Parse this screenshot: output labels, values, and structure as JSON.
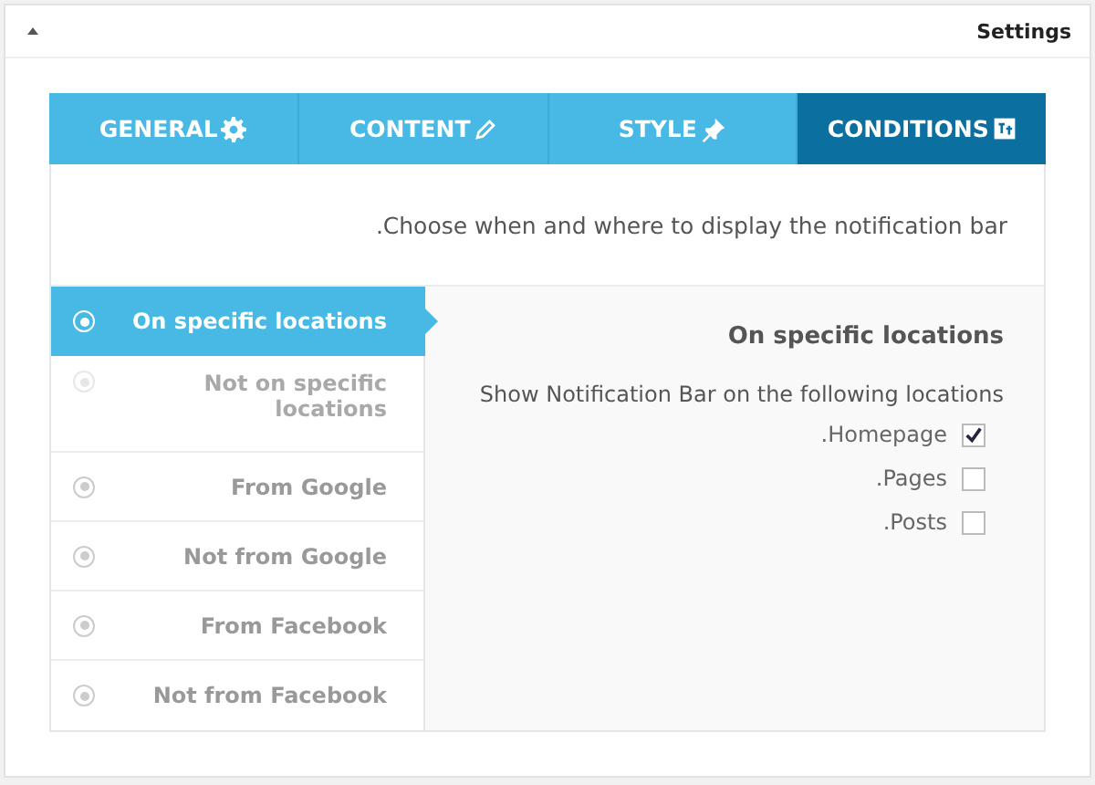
{
  "panel": {
    "title": "Settings",
    "expanded": true
  },
  "tabs": [
    {
      "label": "GENERAL",
      "selected": false
    },
    {
      "label": "CONTENT",
      "selected": false
    },
    {
      "label": "STYLE",
      "selected": false
    },
    {
      "label": "CONDITIONS",
      "selected": true
    }
  ],
  "description": ".Choose when and where to display the notification bar",
  "conditions": [
    {
      "label": "On specific locations",
      "selected": true,
      "disabled": false
    },
    {
      "label": "Not on specific locations",
      "selected": false,
      "disabled": true
    },
    {
      "label": "From Google",
      "selected": false,
      "disabled": false
    },
    {
      "label": "Not from Google",
      "selected": false,
      "disabled": false
    },
    {
      "label": "From Facebook",
      "selected": false,
      "disabled": false
    },
    {
      "label": "Not from Facebook",
      "selected": false,
      "disabled": false
    }
  ],
  "detail": {
    "heading": "On specific locations",
    "subheading": "Show Notification Bar on the following locations",
    "locations": [
      {
        "label": ".Homepage",
        "checked": true
      },
      {
        "label": ".Pages",
        "checked": false
      },
      {
        "label": ".Posts",
        "checked": false
      }
    ]
  }
}
